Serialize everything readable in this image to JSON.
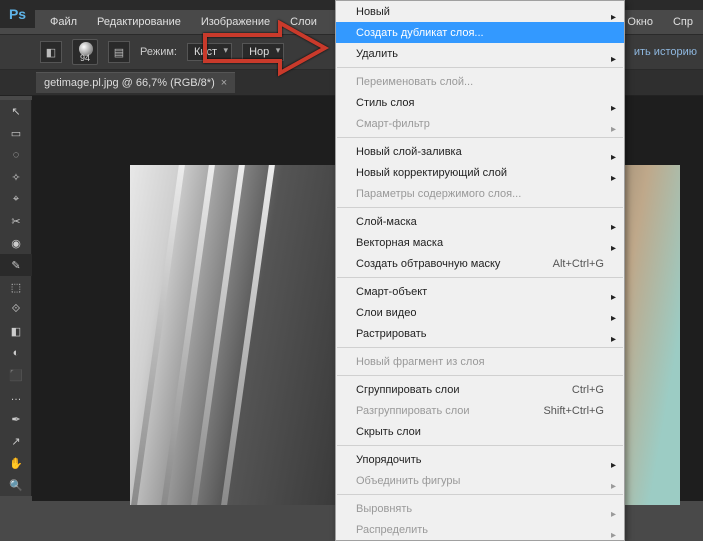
{
  "menubar": {
    "items": [
      "Файл",
      "Редактирование",
      "Изображение",
      "Слои"
    ],
    "right": [
      "Окно",
      "Спр"
    ]
  },
  "optbar": {
    "brush_size": "94",
    "mode_label": "Режим:",
    "mode_value": "Кист",
    "blend_value": "Нор",
    "history_link": "ить историю"
  },
  "tab": {
    "title": "getimage.pl.jpg @ 66,7% (RGB/8*)",
    "close": "×"
  },
  "dropdown": {
    "items": [
      {
        "label": "Новый",
        "submenu": true
      },
      {
        "label": "Создать дубликат слоя...",
        "highlight": true
      },
      {
        "label": "Удалить",
        "submenu": true
      },
      {
        "sep": true
      },
      {
        "label": "Переименовать слой...",
        "disabled": true
      },
      {
        "label": "Стиль слоя",
        "submenu": true
      },
      {
        "label": "Смарт-фильтр",
        "submenu": true,
        "disabled": true
      },
      {
        "sep": true
      },
      {
        "label": "Новый слой-заливка",
        "submenu": true
      },
      {
        "label": "Новый корректирующий слой",
        "submenu": true
      },
      {
        "label": "Параметры содержимого слоя...",
        "disabled": true
      },
      {
        "sep": true
      },
      {
        "label": "Слой-маска",
        "submenu": true
      },
      {
        "label": "Векторная маска",
        "submenu": true
      },
      {
        "label": "Создать обтравочную маску",
        "shortcut": "Alt+Ctrl+G"
      },
      {
        "sep": true
      },
      {
        "label": "Смарт-объект",
        "submenu": true
      },
      {
        "label": "Слои видео",
        "submenu": true
      },
      {
        "label": "Растрировать",
        "submenu": true
      },
      {
        "sep": true
      },
      {
        "label": "Новый фрагмент из слоя",
        "disabled": true
      },
      {
        "sep": true
      },
      {
        "label": "Сгруппировать слои",
        "shortcut": "Ctrl+G"
      },
      {
        "label": "Разгруппировать слои",
        "shortcut": "Shift+Ctrl+G",
        "disabled": true
      },
      {
        "label": "Скрыть слои"
      },
      {
        "sep": true
      },
      {
        "label": "Упорядочить",
        "submenu": true
      },
      {
        "label": "Объединить фигуры",
        "submenu": true,
        "disabled": true
      },
      {
        "sep": true
      },
      {
        "label": "Выровнять",
        "submenu": true,
        "disabled": true
      },
      {
        "label": "Распределить",
        "submenu": true,
        "disabled": true
      }
    ]
  },
  "tools": [
    "↖",
    "▭",
    "◌",
    "✧",
    "⌖",
    "✂",
    "◉",
    "✎",
    "⬚",
    "⟐",
    "◧",
    "◐",
    "⬛",
    "…",
    "✒",
    "↗",
    "✋",
    "🔍",
    "⬛"
  ]
}
